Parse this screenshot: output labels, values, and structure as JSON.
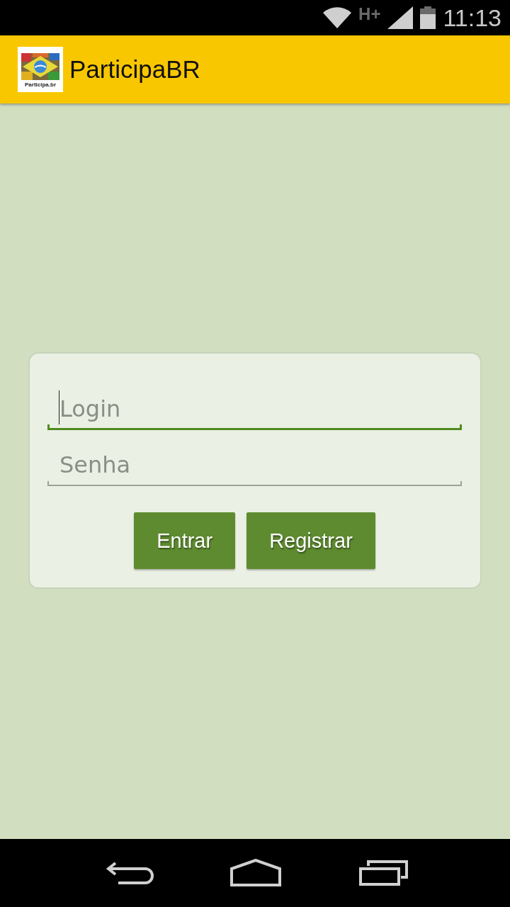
{
  "status_bar": {
    "network": "H+",
    "time": "11:13"
  },
  "app_bar": {
    "logo_text": "Participa.br",
    "title": "ParticipaBR"
  },
  "login_form": {
    "fields": [
      {
        "placeholder": "Login",
        "focused": true
      },
      {
        "placeholder": "Senha",
        "focused": false
      }
    ],
    "buttons": [
      "Entrar",
      "Registrar"
    ]
  }
}
